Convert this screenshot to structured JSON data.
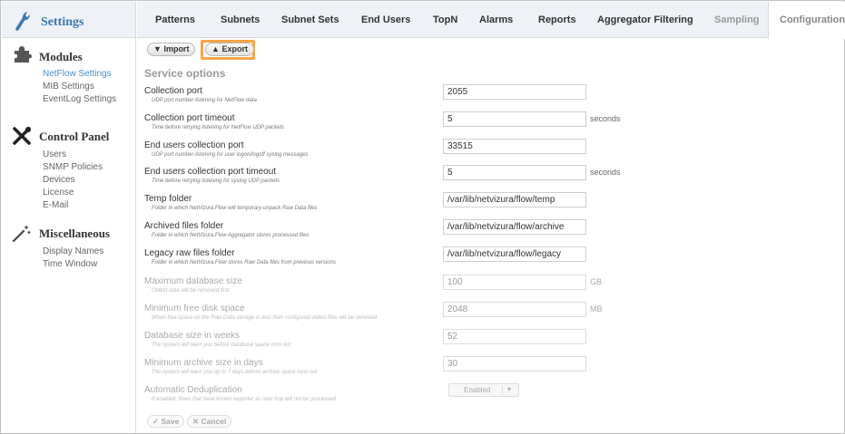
{
  "sidebar": {
    "title": "Settings",
    "sections": [
      {
        "title": "Modules",
        "items": [
          "NetFlow Settings",
          "MIB Settings",
          "EventLog Settings"
        ]
      },
      {
        "title": "Control Panel",
        "items": [
          "Users",
          "SNMP Policies",
          "Devices",
          "License",
          "E-Mail"
        ]
      },
      {
        "title": "Miscellaneous",
        "items": [
          "Display Names",
          "Time Window"
        ]
      }
    ]
  },
  "tabs": [
    "Patterns",
    "Subnets",
    "Subnet Sets",
    "End Users",
    "TopN",
    "Alarms",
    "Reports",
    "Aggregator Filtering",
    "Sampling",
    "Configuration"
  ],
  "toolbar": {
    "import": "Import",
    "export": "Export"
  },
  "service_options": {
    "title": "Service options",
    "fields": [
      {
        "label": "Collection port",
        "desc": "UDP port number listening for NetFlow data",
        "value": "2055",
        "unit": ""
      },
      {
        "label": "Collection port timeout",
        "desc": "Time before retrying listening for NetFlow UDP packets",
        "value": "5",
        "unit": "seconds"
      },
      {
        "label": "End users collection port",
        "desc": "UDP port number listening for user logon/logoff syslog messages",
        "value": "33515",
        "unit": ""
      },
      {
        "label": "End users collection port timeout",
        "desc": "Time before retrying listening for syslog UDP packets",
        "value": "5",
        "unit": "seconds"
      },
      {
        "label": "Temp folder",
        "desc": "Folder in which NetVizura.Flow will temporary unpack Raw Data files",
        "value": "/var/lib/netvizura/flow/temp",
        "unit": ""
      },
      {
        "label": "Archived files folder",
        "desc": "Folder in which NetVizura.Flow Aggregator stores processed files",
        "value": "/var/lib/netvizura/flow/archive",
        "unit": ""
      },
      {
        "label": "Legacy raw files folder",
        "desc": "Folder in which NetVizura.Flow stores Raw Data files from previous versions",
        "value": "/var/lib/netvizura/flow/legacy",
        "unit": ""
      },
      {
        "label": "Maximum database size",
        "desc": "Oldest data will be removed first",
        "value": "100",
        "unit": "GB"
      },
      {
        "label": "Minimum free disk space",
        "desc": "When free space on the Raw Data storage is less than configured oldest files will be removed",
        "value": "2048",
        "unit": "MB"
      },
      {
        "label": "Database size in weeks",
        "desc": "The system will warn you before database space runs out",
        "value": "52",
        "unit": ""
      },
      {
        "label": "Minimum archive size in days",
        "desc": "The system will warn you up to 7 days before archive space runs out",
        "value": "30",
        "unit": ""
      }
    ],
    "dedup": {
      "label": "Automatic Deduplication",
      "desc": "If enabled, flows that have known exporter as next hop will not be processed",
      "value": "Enabled"
    }
  },
  "actions": {
    "save": "Save",
    "cancel": "Cancel"
  },
  "colors": {
    "accent": "#3c78b4",
    "highlight": "#f7a547",
    "active_link": "#4a8fc8"
  },
  "icons": {
    "settings": "wrench-icon",
    "modules": "puzzle-icon",
    "control_panel": "tools-icon",
    "misc": "wand-icon"
  }
}
